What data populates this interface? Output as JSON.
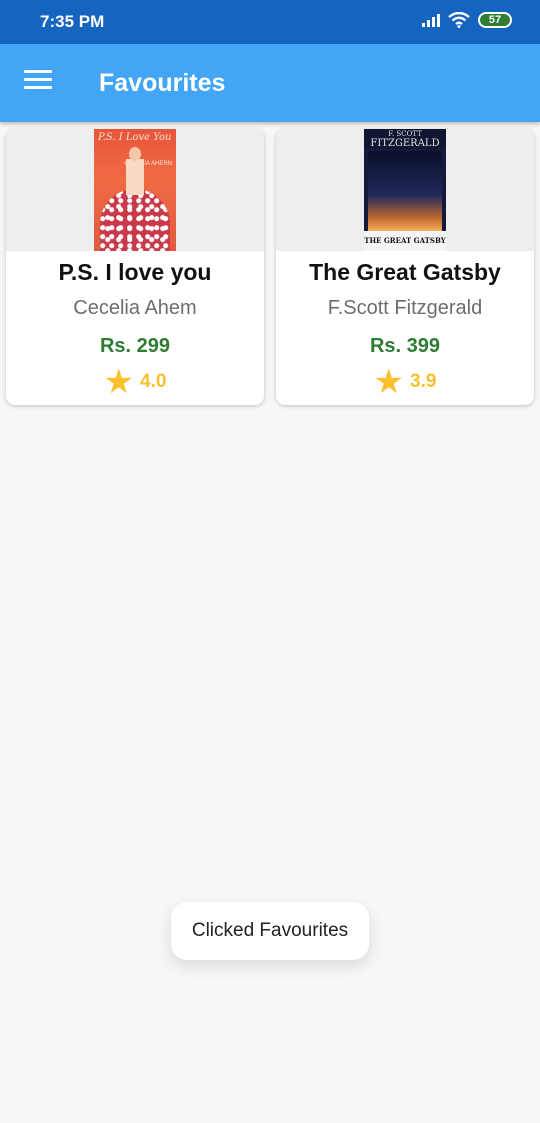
{
  "status_bar": {
    "time": "7:35 PM",
    "battery": "57",
    "icons": [
      "signal-icon",
      "wifi-icon",
      "battery-icon"
    ]
  },
  "app_bar": {
    "title": "Favourites",
    "menu_icon": "hamburger-menu-icon",
    "background": "#42a5f5"
  },
  "books": [
    {
      "title": "P.S. I love you",
      "author": "Cecelia Ahem",
      "price": "Rs. 299",
      "rating": "4.0",
      "cover_text": "P.S. I Love You",
      "cover_author": "CECELIA AHERN"
    },
    {
      "title": "The Great Gatsby",
      "author": "F.Scott Fitzgerald",
      "price": "Rs. 399",
      "rating": "3.9",
      "cover_author_top": "F. SCOTT",
      "cover_author": "FITZGERALD",
      "cover_text": "THE GREAT GATSBY"
    }
  ],
  "toast": {
    "message": "Clicked Favourites"
  },
  "colors": {
    "status_bar": "#1565c0",
    "price": "#2e7d32",
    "rating": "#fbc02d"
  }
}
